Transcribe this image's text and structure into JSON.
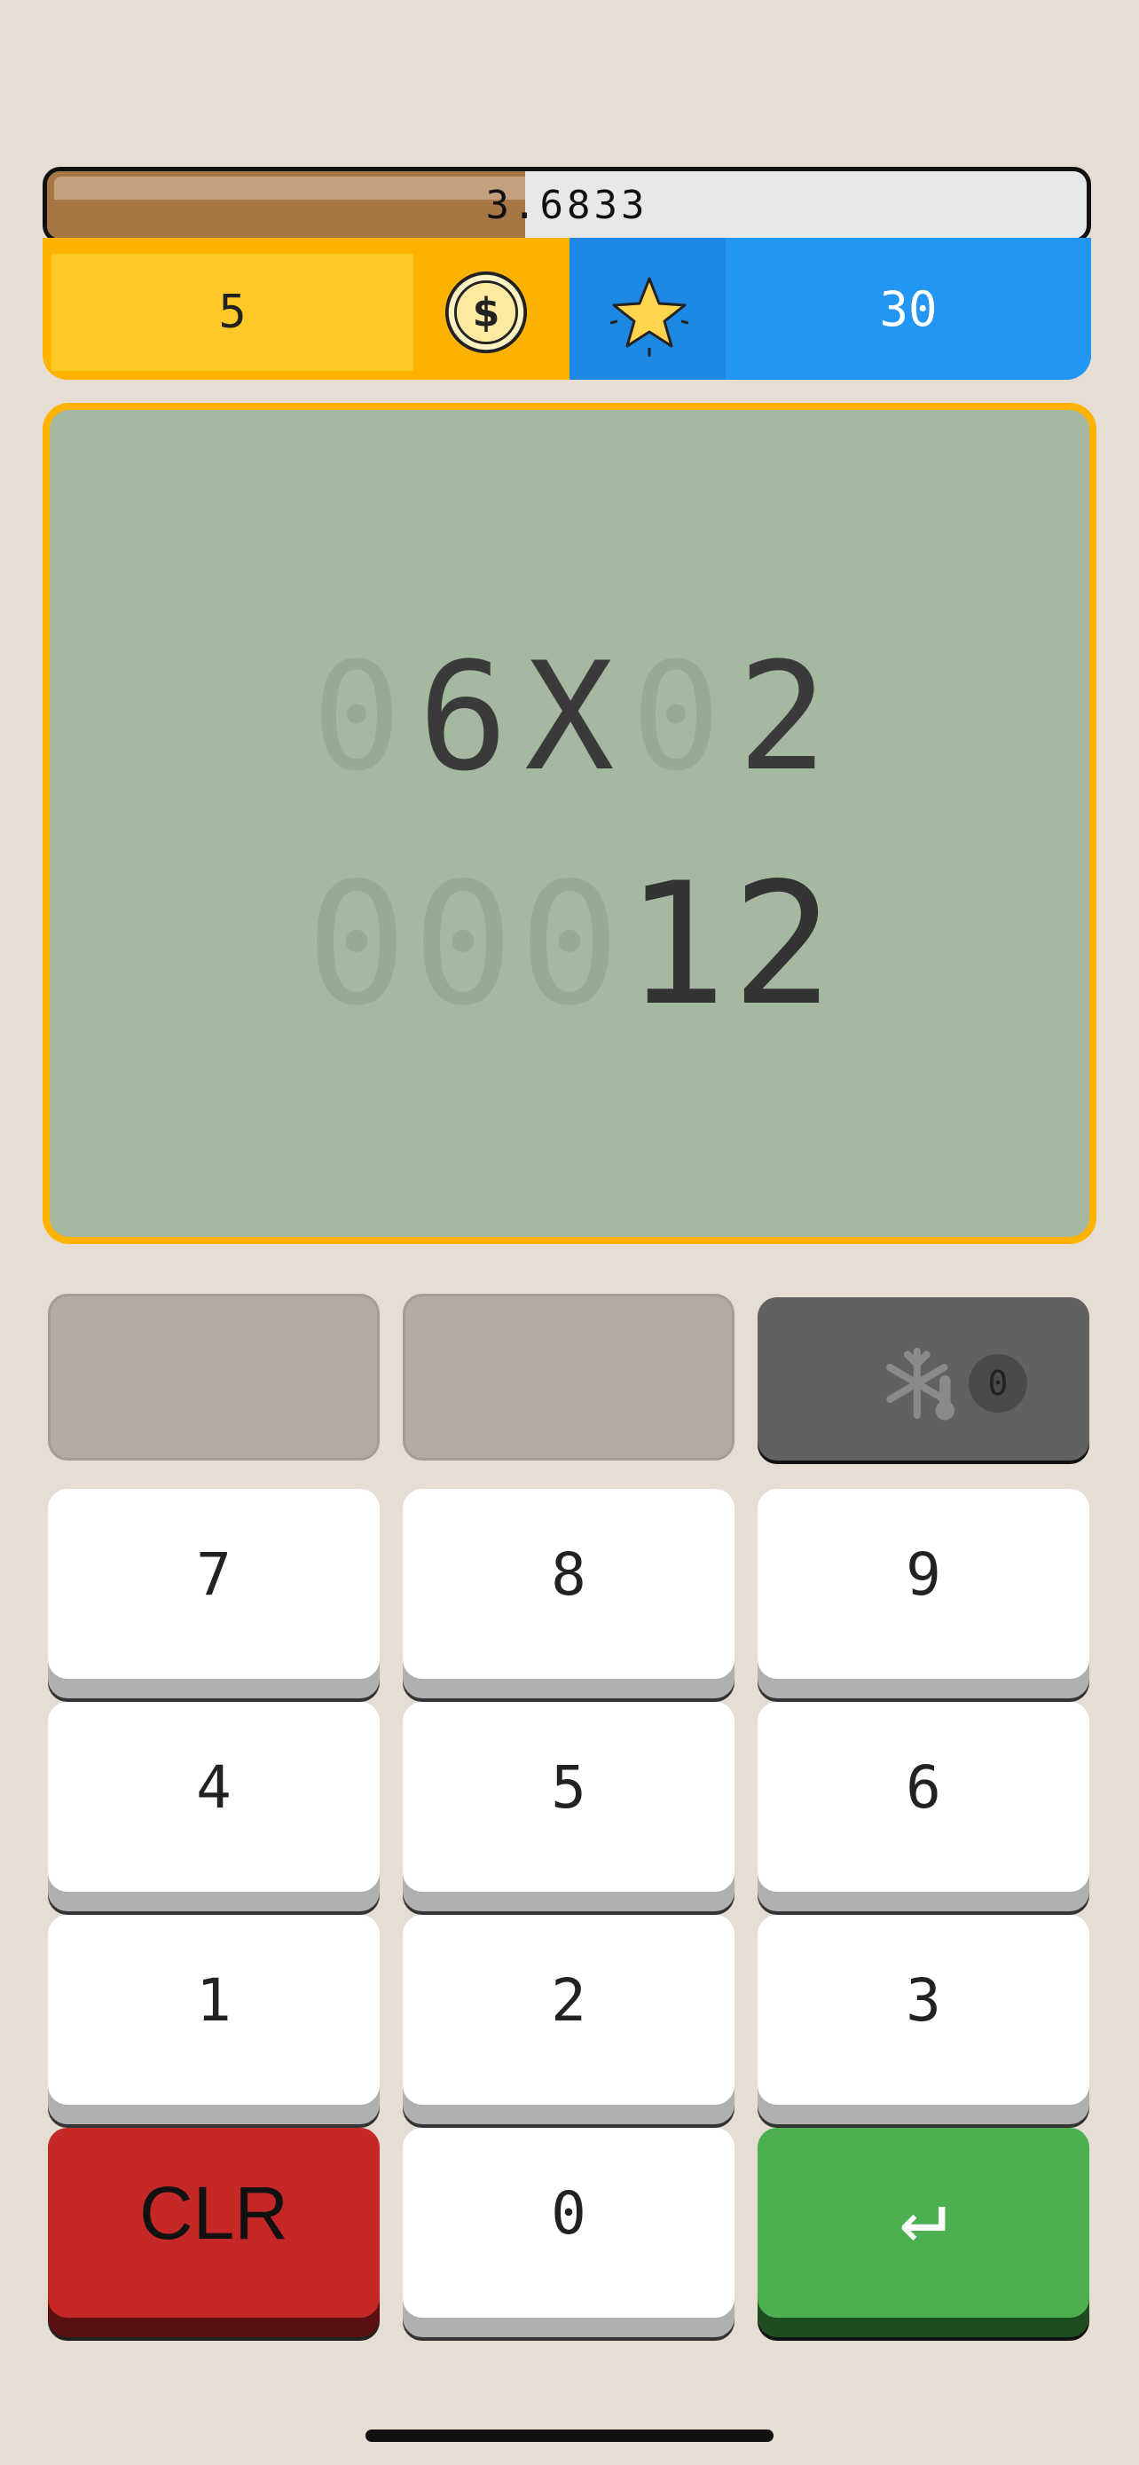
{
  "timer": {
    "value_label": "3.6833",
    "progress": 0.46
  },
  "stats": {
    "coins": "5",
    "stars": "30"
  },
  "display": {
    "problem_digits": [
      {
        "ch": "0",
        "ghost": true
      },
      {
        "ch": "6",
        "ghost": false
      },
      {
        "ch": "X",
        "ghost": false
      },
      {
        "ch": "0",
        "ghost": true
      },
      {
        "ch": "2",
        "ghost": false
      }
    ],
    "answer_digits": [
      {
        "ch": "0",
        "ghost": true
      },
      {
        "ch": "0",
        "ghost": true
      },
      {
        "ch": "0",
        "ghost": true
      },
      {
        "ch": "1",
        "ghost": false
      },
      {
        "ch": "2",
        "ghost": false
      }
    ]
  },
  "keypad": {
    "freeze_count": "0",
    "k7": "7",
    "k8": "8",
    "k9": "9",
    "k4": "4",
    "k5": "5",
    "k6": "6",
    "k1": "1",
    "k2": "2",
    "k3": "3",
    "clear": "CLR",
    "k0": "0",
    "enter": "↵"
  },
  "colors": {
    "accent": "#FFB300",
    "blue": "#2196F3",
    "red": "#C62828",
    "green": "#4CAF50",
    "panel": "#A5B8A0"
  }
}
